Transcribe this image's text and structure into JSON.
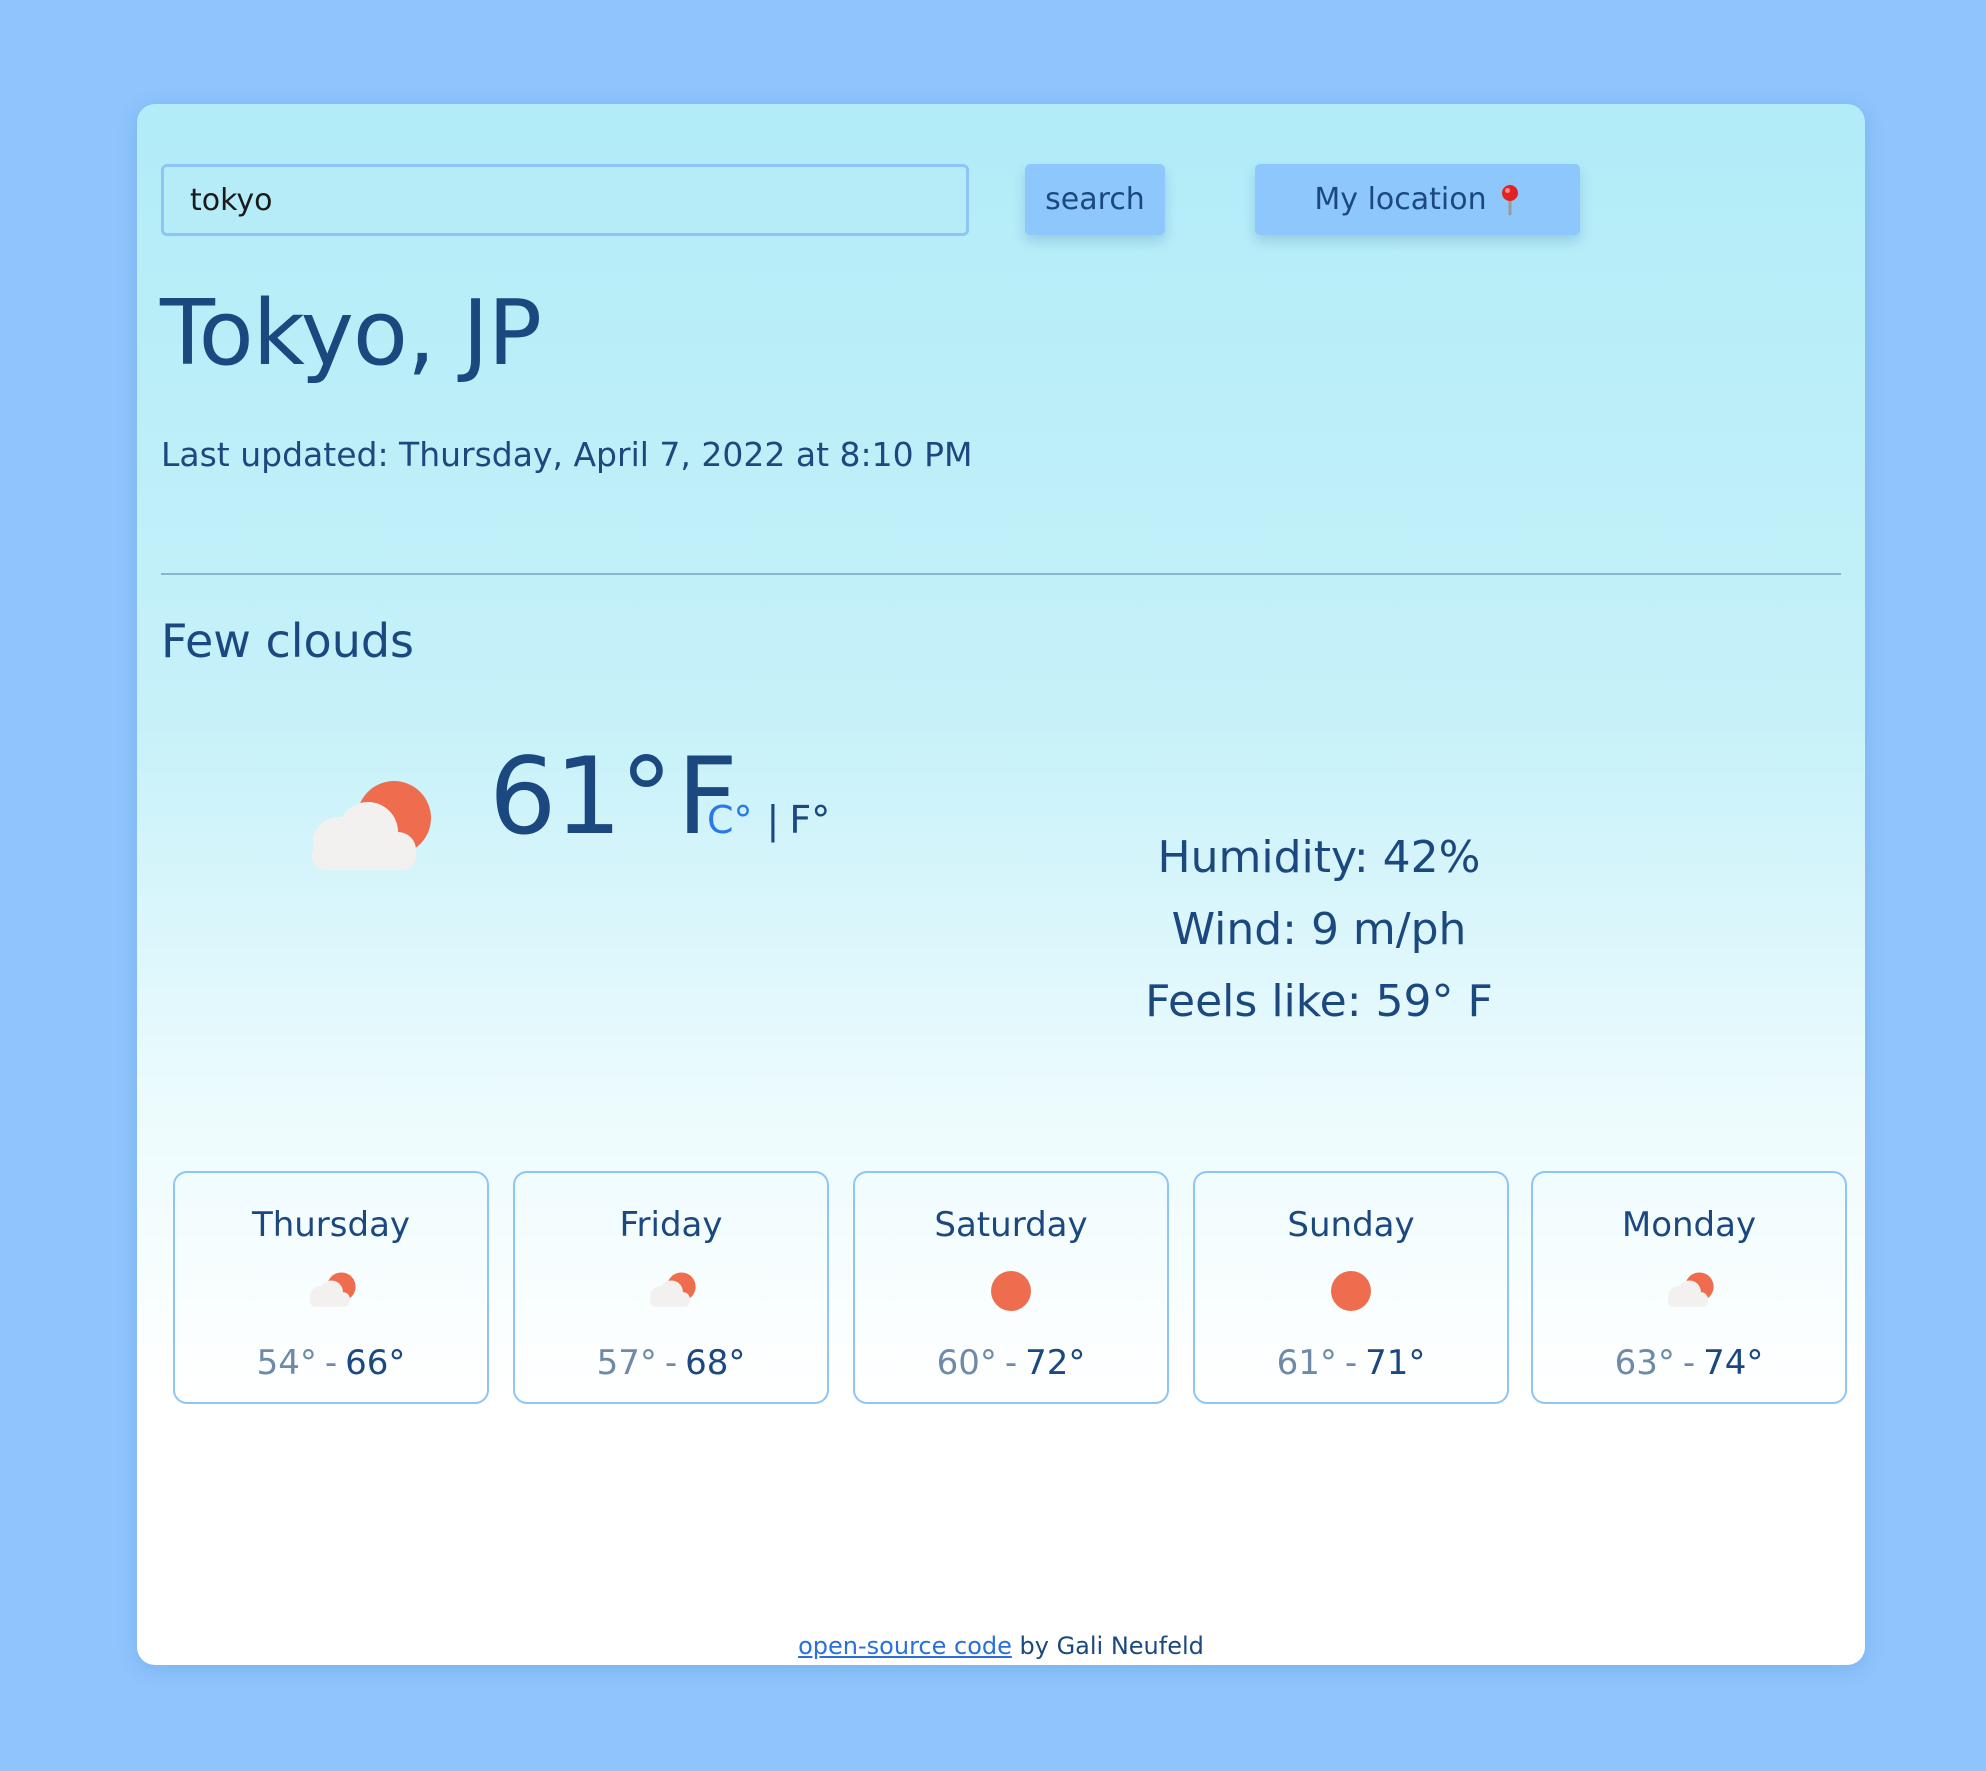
{
  "search": {
    "value": "tokyo",
    "search_label": "search",
    "location_label": "My location"
  },
  "location": {
    "city": "Tokyo, JP",
    "last_updated": "Last updated: Thursday, April 7, 2022 at 8:10 PM"
  },
  "current": {
    "description": "Few clouds",
    "icon": "few-clouds-icon",
    "temperature": "61°",
    "unit": "F",
    "unit_celsius": "C°",
    "unit_separator": "|",
    "unit_fahrenheit": "F°",
    "humidity": "Humidity: 42%",
    "wind": "Wind: 9 m/ph",
    "feels_like": "Feels like: 59° F"
  },
  "forecast": [
    {
      "day": "Thursday",
      "icon": "few-clouds-icon",
      "min": "54°",
      "sep": "-",
      "max": "66°"
    },
    {
      "day": "Friday",
      "icon": "few-clouds-icon",
      "min": "57°",
      "sep": "-",
      "max": "68°"
    },
    {
      "day": "Saturday",
      "icon": "sun-icon",
      "min": "60°",
      "sep": "-",
      "max": "72°"
    },
    {
      "day": "Sunday",
      "icon": "sun-icon",
      "min": "61°",
      "sep": "-",
      "max": "71°"
    },
    {
      "day": "Monday",
      "icon": "few-clouds-icon",
      "min": "63°",
      "sep": "-",
      "max": "74°"
    }
  ],
  "footer": {
    "link_text": "open-source code",
    "author_text": " by Gali Neufeld"
  },
  "colors": {
    "background": "#8fc5fd",
    "accent": "#8ec7fb",
    "text": "#1c4880",
    "link": "#2a78ea",
    "sun": "#ee6d4e",
    "cloud": "#f2f1ef"
  }
}
